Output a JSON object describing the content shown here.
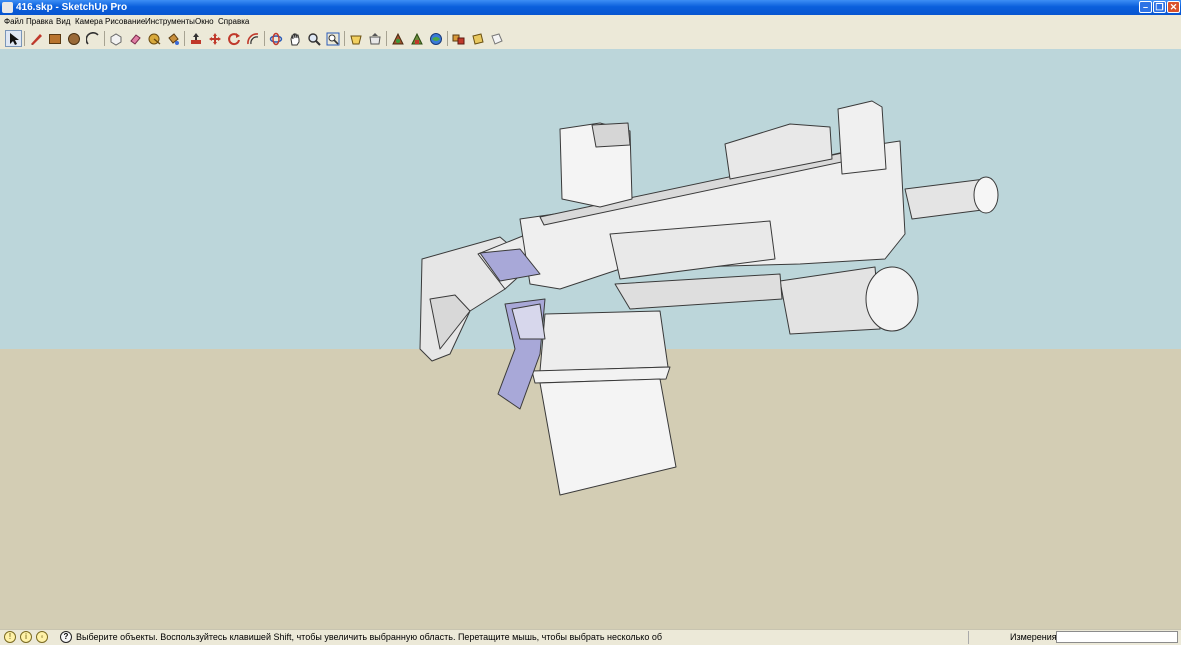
{
  "window": {
    "title": "416.skp - SketchUp Pro"
  },
  "menu": {
    "items": [
      "Файл",
      "Правка",
      "Вид",
      "Камера",
      "Рисование",
      "Инструменты",
      "Окно",
      "Справка"
    ]
  },
  "toolbar": {
    "tools": [
      {
        "icon": "select-arrow-icon",
        "active": true
      },
      {
        "icon": "pencil-line-icon"
      },
      {
        "icon": "rectangle-icon"
      },
      {
        "icon": "circle-icon"
      },
      {
        "icon": "arc-icon"
      },
      {
        "icon": "make-component-icon"
      },
      {
        "icon": "eraser-icon"
      },
      {
        "icon": "tape-measure-icon"
      },
      {
        "icon": "paint-bucket-icon"
      },
      {
        "icon": "push-pull-icon"
      },
      {
        "icon": "move-icon"
      },
      {
        "icon": "rotate-icon"
      },
      {
        "icon": "offset-icon"
      },
      {
        "icon": "orbit-icon"
      },
      {
        "icon": "pan-icon"
      },
      {
        "icon": "zoom-icon"
      },
      {
        "icon": "zoom-extents-icon"
      },
      {
        "icon": "get-models-icon"
      },
      {
        "icon": "share-model-icon"
      },
      {
        "icon": "get-photo-texture-icon"
      },
      {
        "icon": "google-earth-icon"
      },
      {
        "icon": "extension-warehouse-icon"
      },
      {
        "icon": "components-icon"
      },
      {
        "icon": "3d-text-icon"
      }
    ]
  },
  "colors": {
    "sky": "#bcd6da",
    "ground": "#d3cdb4",
    "model": "#eeeeee",
    "accent": "#a8a8d8"
  },
  "status": {
    "hint": "Выберите объекты. Воспользуйтесь клавишей Shift, чтобы увеличить выбранную область. Перетащите мышь, чтобы выбрать несколько об",
    "measure_label": "Измерения",
    "measure_value": ""
  }
}
